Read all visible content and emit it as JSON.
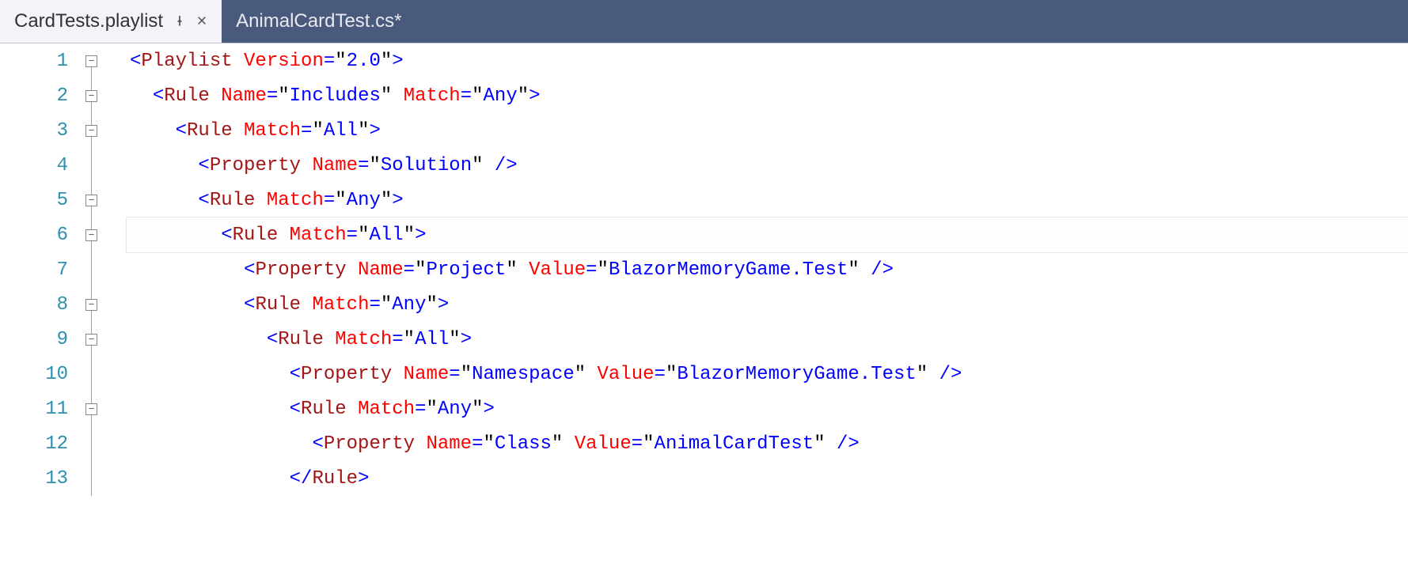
{
  "tabs": [
    {
      "label": "CardTests.playlist",
      "active": true,
      "pinned": false,
      "modified": false
    },
    {
      "label": "AnimalCardTest.cs*",
      "active": false,
      "pinned": false,
      "modified": true
    }
  ],
  "current_line": 6,
  "lines": [
    {
      "num": "1",
      "fold": "minus",
      "indent": 0,
      "tokens": [
        {
          "c": "bracket",
          "t": "<"
        },
        {
          "c": "element",
          "t": "Playlist"
        },
        {
          "c": "plain",
          "t": " "
        },
        {
          "c": "attr",
          "t": "Version"
        },
        {
          "c": "eq",
          "t": "="
        },
        {
          "c": "quote",
          "t": "\""
        },
        {
          "c": "str",
          "t": "2.0"
        },
        {
          "c": "quote",
          "t": "\""
        },
        {
          "c": "bracket",
          "t": ">"
        }
      ]
    },
    {
      "num": "2",
      "fold": "minus",
      "indent": 1,
      "tokens": [
        {
          "c": "bracket",
          "t": "<"
        },
        {
          "c": "element",
          "t": "Rule"
        },
        {
          "c": "plain",
          "t": " "
        },
        {
          "c": "attr",
          "t": "Name"
        },
        {
          "c": "eq",
          "t": "="
        },
        {
          "c": "quote",
          "t": "\""
        },
        {
          "c": "str",
          "t": "Includes"
        },
        {
          "c": "quote",
          "t": "\""
        },
        {
          "c": "plain",
          "t": " "
        },
        {
          "c": "attr",
          "t": "Match"
        },
        {
          "c": "eq",
          "t": "="
        },
        {
          "c": "quote",
          "t": "\""
        },
        {
          "c": "str",
          "t": "Any"
        },
        {
          "c": "quote",
          "t": "\""
        },
        {
          "c": "bracket",
          "t": ">"
        }
      ]
    },
    {
      "num": "3",
      "fold": "minus",
      "indent": 2,
      "tokens": [
        {
          "c": "bracket",
          "t": "<"
        },
        {
          "c": "element",
          "t": "Rule"
        },
        {
          "c": "plain",
          "t": " "
        },
        {
          "c": "attr",
          "t": "Match"
        },
        {
          "c": "eq",
          "t": "="
        },
        {
          "c": "quote",
          "t": "\""
        },
        {
          "c": "str",
          "t": "All"
        },
        {
          "c": "quote",
          "t": "\""
        },
        {
          "c": "bracket",
          "t": ">"
        }
      ]
    },
    {
      "num": "4",
      "fold": "line",
      "indent": 3,
      "tokens": [
        {
          "c": "bracket",
          "t": "<"
        },
        {
          "c": "element",
          "t": "Property"
        },
        {
          "c": "plain",
          "t": " "
        },
        {
          "c": "attr",
          "t": "Name"
        },
        {
          "c": "eq",
          "t": "="
        },
        {
          "c": "quote",
          "t": "\""
        },
        {
          "c": "str",
          "t": "Solution"
        },
        {
          "c": "quote",
          "t": "\""
        },
        {
          "c": "plain",
          "t": " "
        },
        {
          "c": "bracket",
          "t": "/>"
        }
      ]
    },
    {
      "num": "5",
      "fold": "minus",
      "indent": 3,
      "tokens": [
        {
          "c": "bracket",
          "t": "<"
        },
        {
          "c": "element",
          "t": "Rule"
        },
        {
          "c": "plain",
          "t": " "
        },
        {
          "c": "attr",
          "t": "Match"
        },
        {
          "c": "eq",
          "t": "="
        },
        {
          "c": "quote",
          "t": "\""
        },
        {
          "c": "str",
          "t": "Any"
        },
        {
          "c": "quote",
          "t": "\""
        },
        {
          "c": "bracket",
          "t": ">"
        }
      ]
    },
    {
      "num": "6",
      "fold": "minus",
      "indent": 4,
      "tokens": [
        {
          "c": "bracket",
          "t": "<"
        },
        {
          "c": "element",
          "t": "Rule"
        },
        {
          "c": "plain",
          "t": " "
        },
        {
          "c": "attr",
          "t": "Match"
        },
        {
          "c": "eq",
          "t": "="
        },
        {
          "c": "quote",
          "t": "\""
        },
        {
          "c": "str",
          "t": "All"
        },
        {
          "c": "quote",
          "t": "\""
        },
        {
          "c": "bracket",
          "t": ">"
        }
      ]
    },
    {
      "num": "7",
      "fold": "line",
      "indent": 5,
      "tokens": [
        {
          "c": "bracket",
          "t": "<"
        },
        {
          "c": "element",
          "t": "Property"
        },
        {
          "c": "plain",
          "t": " "
        },
        {
          "c": "attr",
          "t": "Name"
        },
        {
          "c": "eq",
          "t": "="
        },
        {
          "c": "quote",
          "t": "\""
        },
        {
          "c": "str",
          "t": "Project"
        },
        {
          "c": "quote",
          "t": "\""
        },
        {
          "c": "plain",
          "t": " "
        },
        {
          "c": "attr",
          "t": "Value"
        },
        {
          "c": "eq",
          "t": "="
        },
        {
          "c": "quote",
          "t": "\""
        },
        {
          "c": "str",
          "t": "BlazorMemoryGame.Test"
        },
        {
          "c": "quote",
          "t": "\""
        },
        {
          "c": "plain",
          "t": " "
        },
        {
          "c": "bracket",
          "t": "/>"
        }
      ]
    },
    {
      "num": "8",
      "fold": "minus",
      "indent": 5,
      "tokens": [
        {
          "c": "bracket",
          "t": "<"
        },
        {
          "c": "element",
          "t": "Rule"
        },
        {
          "c": "plain",
          "t": " "
        },
        {
          "c": "attr",
          "t": "Match"
        },
        {
          "c": "eq",
          "t": "="
        },
        {
          "c": "quote",
          "t": "\""
        },
        {
          "c": "str",
          "t": "Any"
        },
        {
          "c": "quote",
          "t": "\""
        },
        {
          "c": "bracket",
          "t": ">"
        }
      ]
    },
    {
      "num": "9",
      "fold": "minus",
      "indent": 6,
      "tokens": [
        {
          "c": "bracket",
          "t": "<"
        },
        {
          "c": "element",
          "t": "Rule"
        },
        {
          "c": "plain",
          "t": " "
        },
        {
          "c": "attr",
          "t": "Match"
        },
        {
          "c": "eq",
          "t": "="
        },
        {
          "c": "quote",
          "t": "\""
        },
        {
          "c": "str",
          "t": "All"
        },
        {
          "c": "quote",
          "t": "\""
        },
        {
          "c": "bracket",
          "t": ">"
        }
      ]
    },
    {
      "num": "10",
      "fold": "line",
      "indent": 7,
      "tokens": [
        {
          "c": "bracket",
          "t": "<"
        },
        {
          "c": "element",
          "t": "Property"
        },
        {
          "c": "plain",
          "t": " "
        },
        {
          "c": "attr",
          "t": "Name"
        },
        {
          "c": "eq",
          "t": "="
        },
        {
          "c": "quote",
          "t": "\""
        },
        {
          "c": "str",
          "t": "Namespace"
        },
        {
          "c": "quote",
          "t": "\""
        },
        {
          "c": "plain",
          "t": " "
        },
        {
          "c": "attr",
          "t": "Value"
        },
        {
          "c": "eq",
          "t": "="
        },
        {
          "c": "quote",
          "t": "\""
        },
        {
          "c": "str",
          "t": "BlazorMemoryGame.Test"
        },
        {
          "c": "quote",
          "t": "\""
        },
        {
          "c": "plain",
          "t": " "
        },
        {
          "c": "bracket",
          "t": "/>"
        }
      ]
    },
    {
      "num": "11",
      "fold": "minus",
      "indent": 7,
      "tokens": [
        {
          "c": "bracket",
          "t": "<"
        },
        {
          "c": "element",
          "t": "Rule"
        },
        {
          "c": "plain",
          "t": " "
        },
        {
          "c": "attr",
          "t": "Match"
        },
        {
          "c": "eq",
          "t": "="
        },
        {
          "c": "quote",
          "t": "\""
        },
        {
          "c": "str",
          "t": "Any"
        },
        {
          "c": "quote",
          "t": "\""
        },
        {
          "c": "bracket",
          "t": ">"
        }
      ]
    },
    {
      "num": "12",
      "fold": "line",
      "indent": 8,
      "tokens": [
        {
          "c": "bracket",
          "t": "<"
        },
        {
          "c": "element",
          "t": "Property"
        },
        {
          "c": "plain",
          "t": " "
        },
        {
          "c": "attr",
          "t": "Name"
        },
        {
          "c": "eq",
          "t": "="
        },
        {
          "c": "quote",
          "t": "\""
        },
        {
          "c": "str",
          "t": "Class"
        },
        {
          "c": "quote",
          "t": "\""
        },
        {
          "c": "plain",
          "t": " "
        },
        {
          "c": "attr",
          "t": "Value"
        },
        {
          "c": "eq",
          "t": "="
        },
        {
          "c": "quote",
          "t": "\""
        },
        {
          "c": "str",
          "t": "AnimalCardTest"
        },
        {
          "c": "quote",
          "t": "\""
        },
        {
          "c": "plain",
          "t": " "
        },
        {
          "c": "bracket",
          "t": "/>"
        }
      ]
    },
    {
      "num": "13",
      "fold": "line",
      "indent": 7,
      "tokens": [
        {
          "c": "bracket",
          "t": "</"
        },
        {
          "c": "element",
          "t": "Rule"
        },
        {
          "c": "bracket",
          "t": ">"
        }
      ]
    }
  ]
}
